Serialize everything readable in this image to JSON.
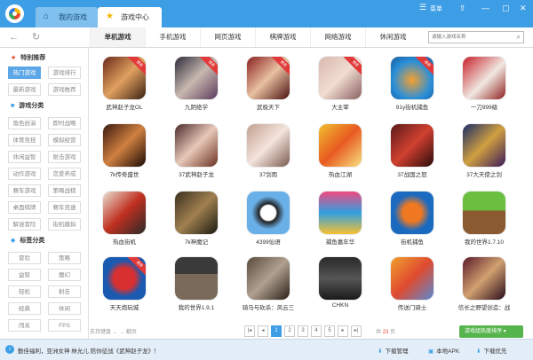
{
  "titlebar": {
    "tabs": [
      {
        "label": "我的游戏"
      },
      {
        "label": "游戏中心"
      }
    ],
    "menu_label": "菜单"
  },
  "toolbar": {
    "categories": [
      "单机游戏",
      "手机游戏",
      "网页游戏",
      "棋牌游戏",
      "网络游戏",
      "休闲游戏"
    ],
    "search_placeholder": "请输入游戏名称"
  },
  "sidebar": {
    "featured": {
      "title": "特别推荐",
      "items": [
        "热门游戏",
        "游戏排行",
        "最新游戏",
        "游戏推荐"
      ]
    },
    "category": {
      "title": "游戏分类",
      "items": [
        "角色扮演",
        "即时战略",
        "体育竞技",
        "模拟经营",
        "休闲益智",
        "射击游戏",
        "动作游戏",
        "恋爱养成",
        "赛车游戏",
        "策略战棋",
        "桌面棋牌",
        "赛车竞速",
        "解谜冒险",
        "街机模拟"
      ]
    },
    "tags": {
      "title": "标签分类",
      "items": [
        "冒险",
        "策略",
        "益智",
        "魔幻",
        "轻松",
        "射击",
        "经典",
        "休闲",
        "闯关",
        "FPS"
      ]
    }
  },
  "colors": {
    "accent": "#3d9ee6",
    "badge": "#e23a3a",
    "green": "#56b44c"
  },
  "games": [
    {
      "name": "武神赵子龙OL",
      "badge": "推荐"
    },
    {
      "name": "九阴绝学",
      "badge": "推荐"
    },
    {
      "name": "武极天下",
      "badge": "推荐"
    },
    {
      "name": "大主宰",
      "badge": "推荐"
    },
    {
      "name": "91y街机捕鱼",
      "badge": "推荐"
    },
    {
      "name": "一刀999级",
      "badge": ""
    },
    {
      "name": "7k传奇盛世",
      "badge": ""
    },
    {
      "name": "37武神赵子龙",
      "badge": ""
    },
    {
      "name": "37剑雨",
      "badge": ""
    },
    {
      "name": "热血江湖",
      "badge": ""
    },
    {
      "name": "37战国之怒",
      "badge": ""
    },
    {
      "name": "37大天使之剑",
      "badge": ""
    },
    {
      "name": "热血街机",
      "badge": ""
    },
    {
      "name": "7k神魔记",
      "badge": ""
    },
    {
      "name": "4399仙语",
      "badge": ""
    },
    {
      "name": "捕鱼嘉年华",
      "badge": ""
    },
    {
      "name": "街机捕鱼",
      "badge": ""
    },
    {
      "name": "我的世界1.7.10",
      "badge": ""
    },
    {
      "name": "天天炮玩城",
      "badge": "推荐"
    },
    {
      "name": "我的世界1.9.1",
      "badge": ""
    },
    {
      "name": "骑马与砍杀：风云三",
      "badge": ""
    },
    {
      "name": "CHKN",
      "badge": ""
    },
    {
      "name": "传送门骑士",
      "badge": ""
    },
    {
      "name": "信长之野望创造：战",
      "badge": ""
    }
  ],
  "pagination": {
    "hint": "支持键盘 ← → 翻页",
    "pages": [
      "1",
      "2",
      "3",
      "4",
      "5"
    ],
    "total_prefix": "共",
    "total": "23",
    "total_suffix": "页",
    "open_label": "游戏组热度排序"
  },
  "statusbar": {
    "message": "勤佳福利，亚洲女神 林允儿 陪你征战《武神赵子龙》！",
    "links": [
      "下载管理",
      "本地APK",
      "下载优先"
    ]
  }
}
